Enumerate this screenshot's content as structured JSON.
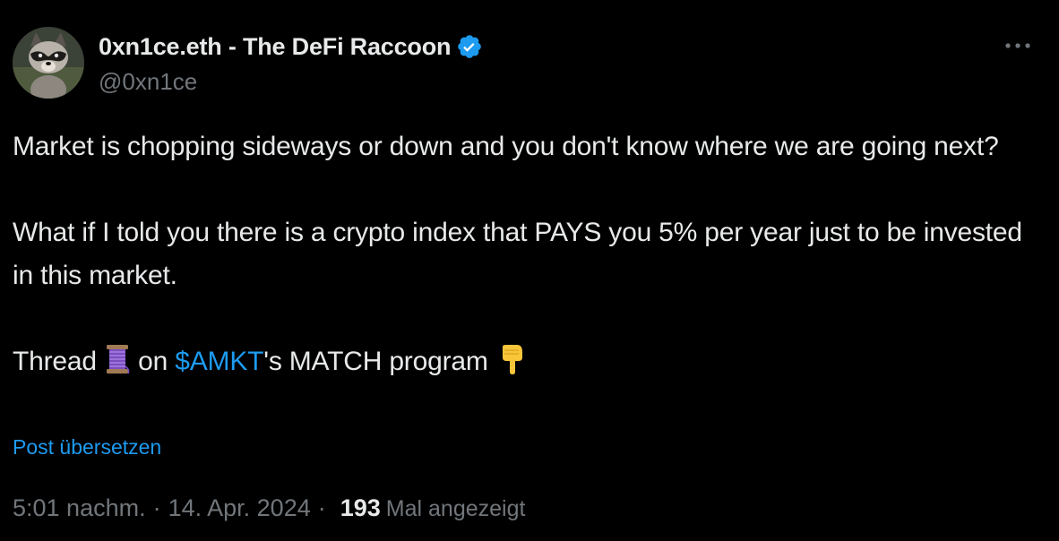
{
  "author": {
    "display_name": "0xn1ce.eth - The DeFi Raccoon",
    "handle": "@0xn1ce",
    "verified": true,
    "avatar_icon": "raccoon-avatar"
  },
  "more_menu_icon": "more-options-icon",
  "tweet": {
    "line1": "Market is chopping sideways or down and you don't know where we are going next?",
    "line2": "What if I told you there is a crypto index that PAYS you 5% per year just to be invested in this market.",
    "line3_prefix": "Thread",
    "line3_on": "on",
    "cashtag": "$AMKT",
    "line3_suffix": "'s MATCH program",
    "thread_emoji": "spool-of-thread-emoji",
    "pointing_emoji": "backhand-index-pointing-down-emoji"
  },
  "translate_link": "Post übersetzen",
  "meta": {
    "time": "5:01 nachm.",
    "separator": "·",
    "date": "14. Apr. 2024",
    "views_count": "193",
    "views_label": "Mal angezeigt"
  },
  "colors": {
    "background": "#000000",
    "text": "#e7e9ea",
    "secondary": "#71767b",
    "accent": "#1d9bf0"
  }
}
